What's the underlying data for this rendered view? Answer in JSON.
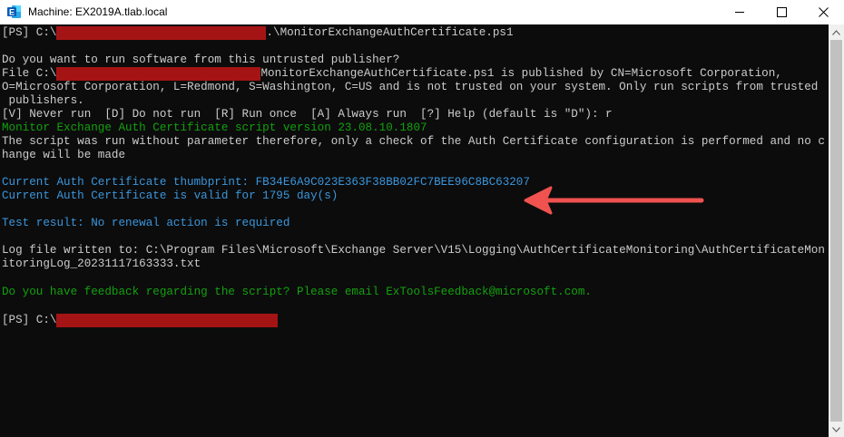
{
  "window": {
    "title": "Machine: EX2019A.tlab.local",
    "icon": "exchange-icon",
    "controls": [
      "minimize-icon",
      "maximize-icon",
      "close-icon"
    ]
  },
  "console": {
    "line1_prefix": "[PS] C:\\",
    "line1_suffix": ".\\MonitorExchangeAuthCertificate.ps1",
    "line3": "Do you want to run software from this untrusted publisher?",
    "line4_prefix": "File C:\\",
    "line4_suffix": "MonitorExchangeAuthCertificate.ps1 is published by CN=Microsoft Corporation,",
    "line5": "O=Microsoft Corporation, L=Redmond, S=Washington, C=US and is not trusted on your system. Only run scripts from trusted",
    "line6": " publishers.",
    "line7": "[V] Never run  [D] Do not run  [R] Run once  [A] Always run  [?] Help (default is \"D\"): r",
    "line8": "Monitor Exchange Auth Certificate script version 23.08.10.1807",
    "line9": "The script was run without parameter therefore, only a check of the Auth Certificate configuration is performed and no c",
    "line10": "hange will be made",
    "line12": "Current Auth Certificate thumbprint: FB34E6A9C023E363F38BB02FC7BEE96C8BC63207",
    "line13": "Current Auth Certificate is valid for 1795 day(s)",
    "line15": "Test result: No renewal action is required",
    "line17": "Log file written to: C:\\Program Files\\Microsoft\\Exchange Server\\V15\\Logging\\AuthCertificateMonitoring\\AuthCertificateMon",
    "line18": "itoringLog_20231117163333.txt",
    "line20": "Do you have feedback regarding the script? Please email ExToolsFeedback@microsoft.com.",
    "line22_prefix": "[PS] C:\\"
  },
  "colors": {
    "console_bg": "#0c0c0c",
    "text": "#cccccc",
    "green": "#13a10e",
    "cyan": "#3a96dd",
    "redaction": "#a51414",
    "annotation_arrow": "#f0524f"
  }
}
